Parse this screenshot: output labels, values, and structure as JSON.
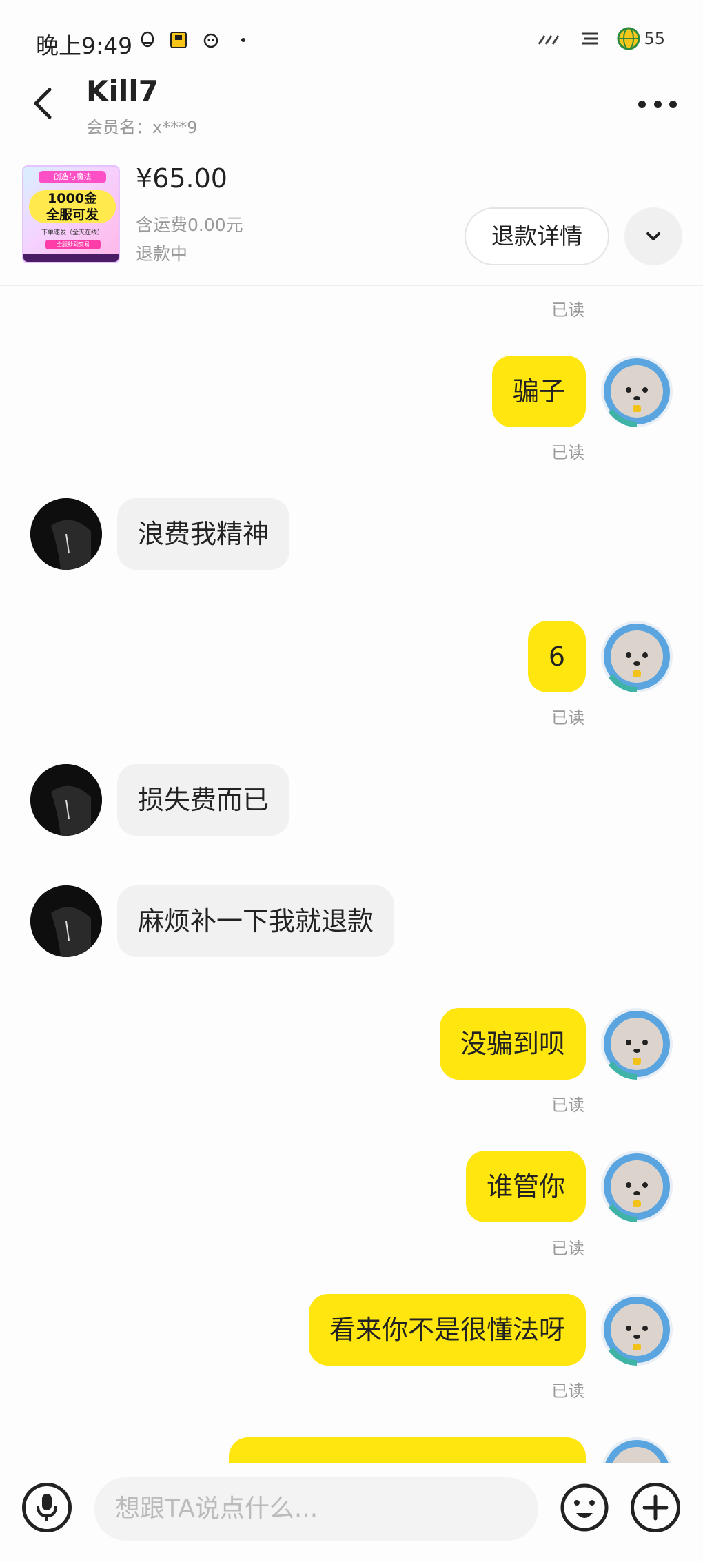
{
  "status_bar": {
    "time": "晚上9:49",
    "battery": "55"
  },
  "header": {
    "nickname": "Kill7",
    "member_label": "会员名：x***9"
  },
  "product": {
    "image_text": {
      "banner": "创造与魔法",
      "headline_1": "1000金",
      "headline_2": "全服可发",
      "subline": "下单速发（全天在线）",
      "tag": "全服秒到交易"
    },
    "price": "¥65.00",
    "shipping": "含运费0.00元",
    "status": "退款中",
    "refund_button": "退款详情"
  },
  "messages": [
    {
      "id": "r0",
      "read": "已读"
    },
    {
      "id": "m1",
      "side": "mine",
      "text": "骗子",
      "read": "已读"
    },
    {
      "id": "m2",
      "side": "theirs",
      "text": "浪费我精神"
    },
    {
      "id": "m3",
      "side": "mine",
      "text": "6",
      "read": "已读"
    },
    {
      "id": "m4",
      "side": "theirs",
      "text": "损失费而已"
    },
    {
      "id": "m5",
      "side": "theirs",
      "text": "麻烦补一下我就退款"
    },
    {
      "id": "m6",
      "side": "mine",
      "text": "没骗到呗",
      "read": "已读"
    },
    {
      "id": "m7",
      "side": "mine",
      "text": "谁管你",
      "read": "已读"
    },
    {
      "id": "m8",
      "side": "mine",
      "text": "看来你不是很懂法呀",
      "read": "已读"
    },
    {
      "id": "m9",
      "side": "mine",
      "text": ""
    }
  ],
  "input": {
    "placeholder": "想跟TA说点什么..."
  },
  "colors": {
    "my_bubble": "#ffe60f",
    "their_bubble": "#f1f1f1",
    "read_text": "#999999"
  },
  "icons": [
    "back-arrow-icon",
    "more-icon",
    "chevron-down-icon",
    "microphone-icon",
    "emoji-icon",
    "plus-icon"
  ]
}
